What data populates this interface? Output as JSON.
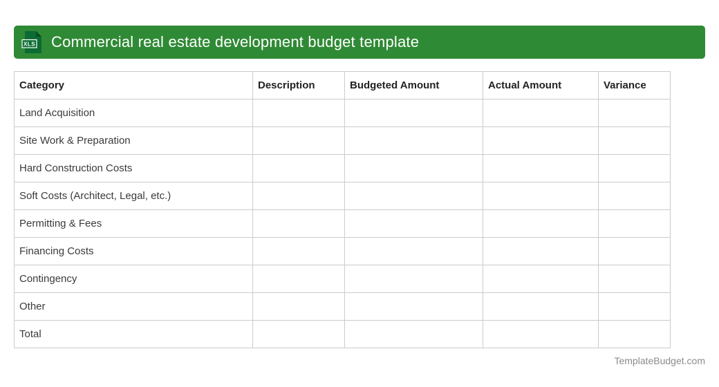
{
  "banner": {
    "title": "Commercial real estate development budget template",
    "background_color": "#2F8A35",
    "icon": {
      "type": "xls-file-icon",
      "label": "XLS",
      "doc_color": "#0C6B33"
    }
  },
  "table": {
    "columns": [
      "Category",
      "Description",
      "Budgeted Amount",
      "Actual Amount",
      "Variance"
    ],
    "rows": [
      {
        "category": "Land Acquisition",
        "description": "",
        "budgeted_amount": "",
        "actual_amount": "",
        "variance": ""
      },
      {
        "category": "Site Work & Preparation",
        "description": "",
        "budgeted_amount": "",
        "actual_amount": "",
        "variance": ""
      },
      {
        "category": "Hard Construction Costs",
        "description": "",
        "budgeted_amount": "",
        "actual_amount": "",
        "variance": ""
      },
      {
        "category": "Soft Costs (Architect, Legal, etc.)",
        "description": "",
        "budgeted_amount": "",
        "actual_amount": "",
        "variance": ""
      },
      {
        "category": "Permitting & Fees",
        "description": "",
        "budgeted_amount": "",
        "actual_amount": "",
        "variance": ""
      },
      {
        "category": "Financing Costs",
        "description": "",
        "budgeted_amount": "",
        "actual_amount": "",
        "variance": ""
      },
      {
        "category": "Contingency",
        "description": "",
        "budgeted_amount": "",
        "actual_amount": "",
        "variance": ""
      },
      {
        "category": "Other",
        "description": "",
        "budgeted_amount": "",
        "actual_amount": "",
        "variance": ""
      },
      {
        "category": "Total",
        "description": "",
        "budgeted_amount": "",
        "actual_amount": "",
        "variance": ""
      }
    ],
    "border_color": "#cbcbcb"
  },
  "footer": {
    "text": "TemplateBudget.com"
  }
}
